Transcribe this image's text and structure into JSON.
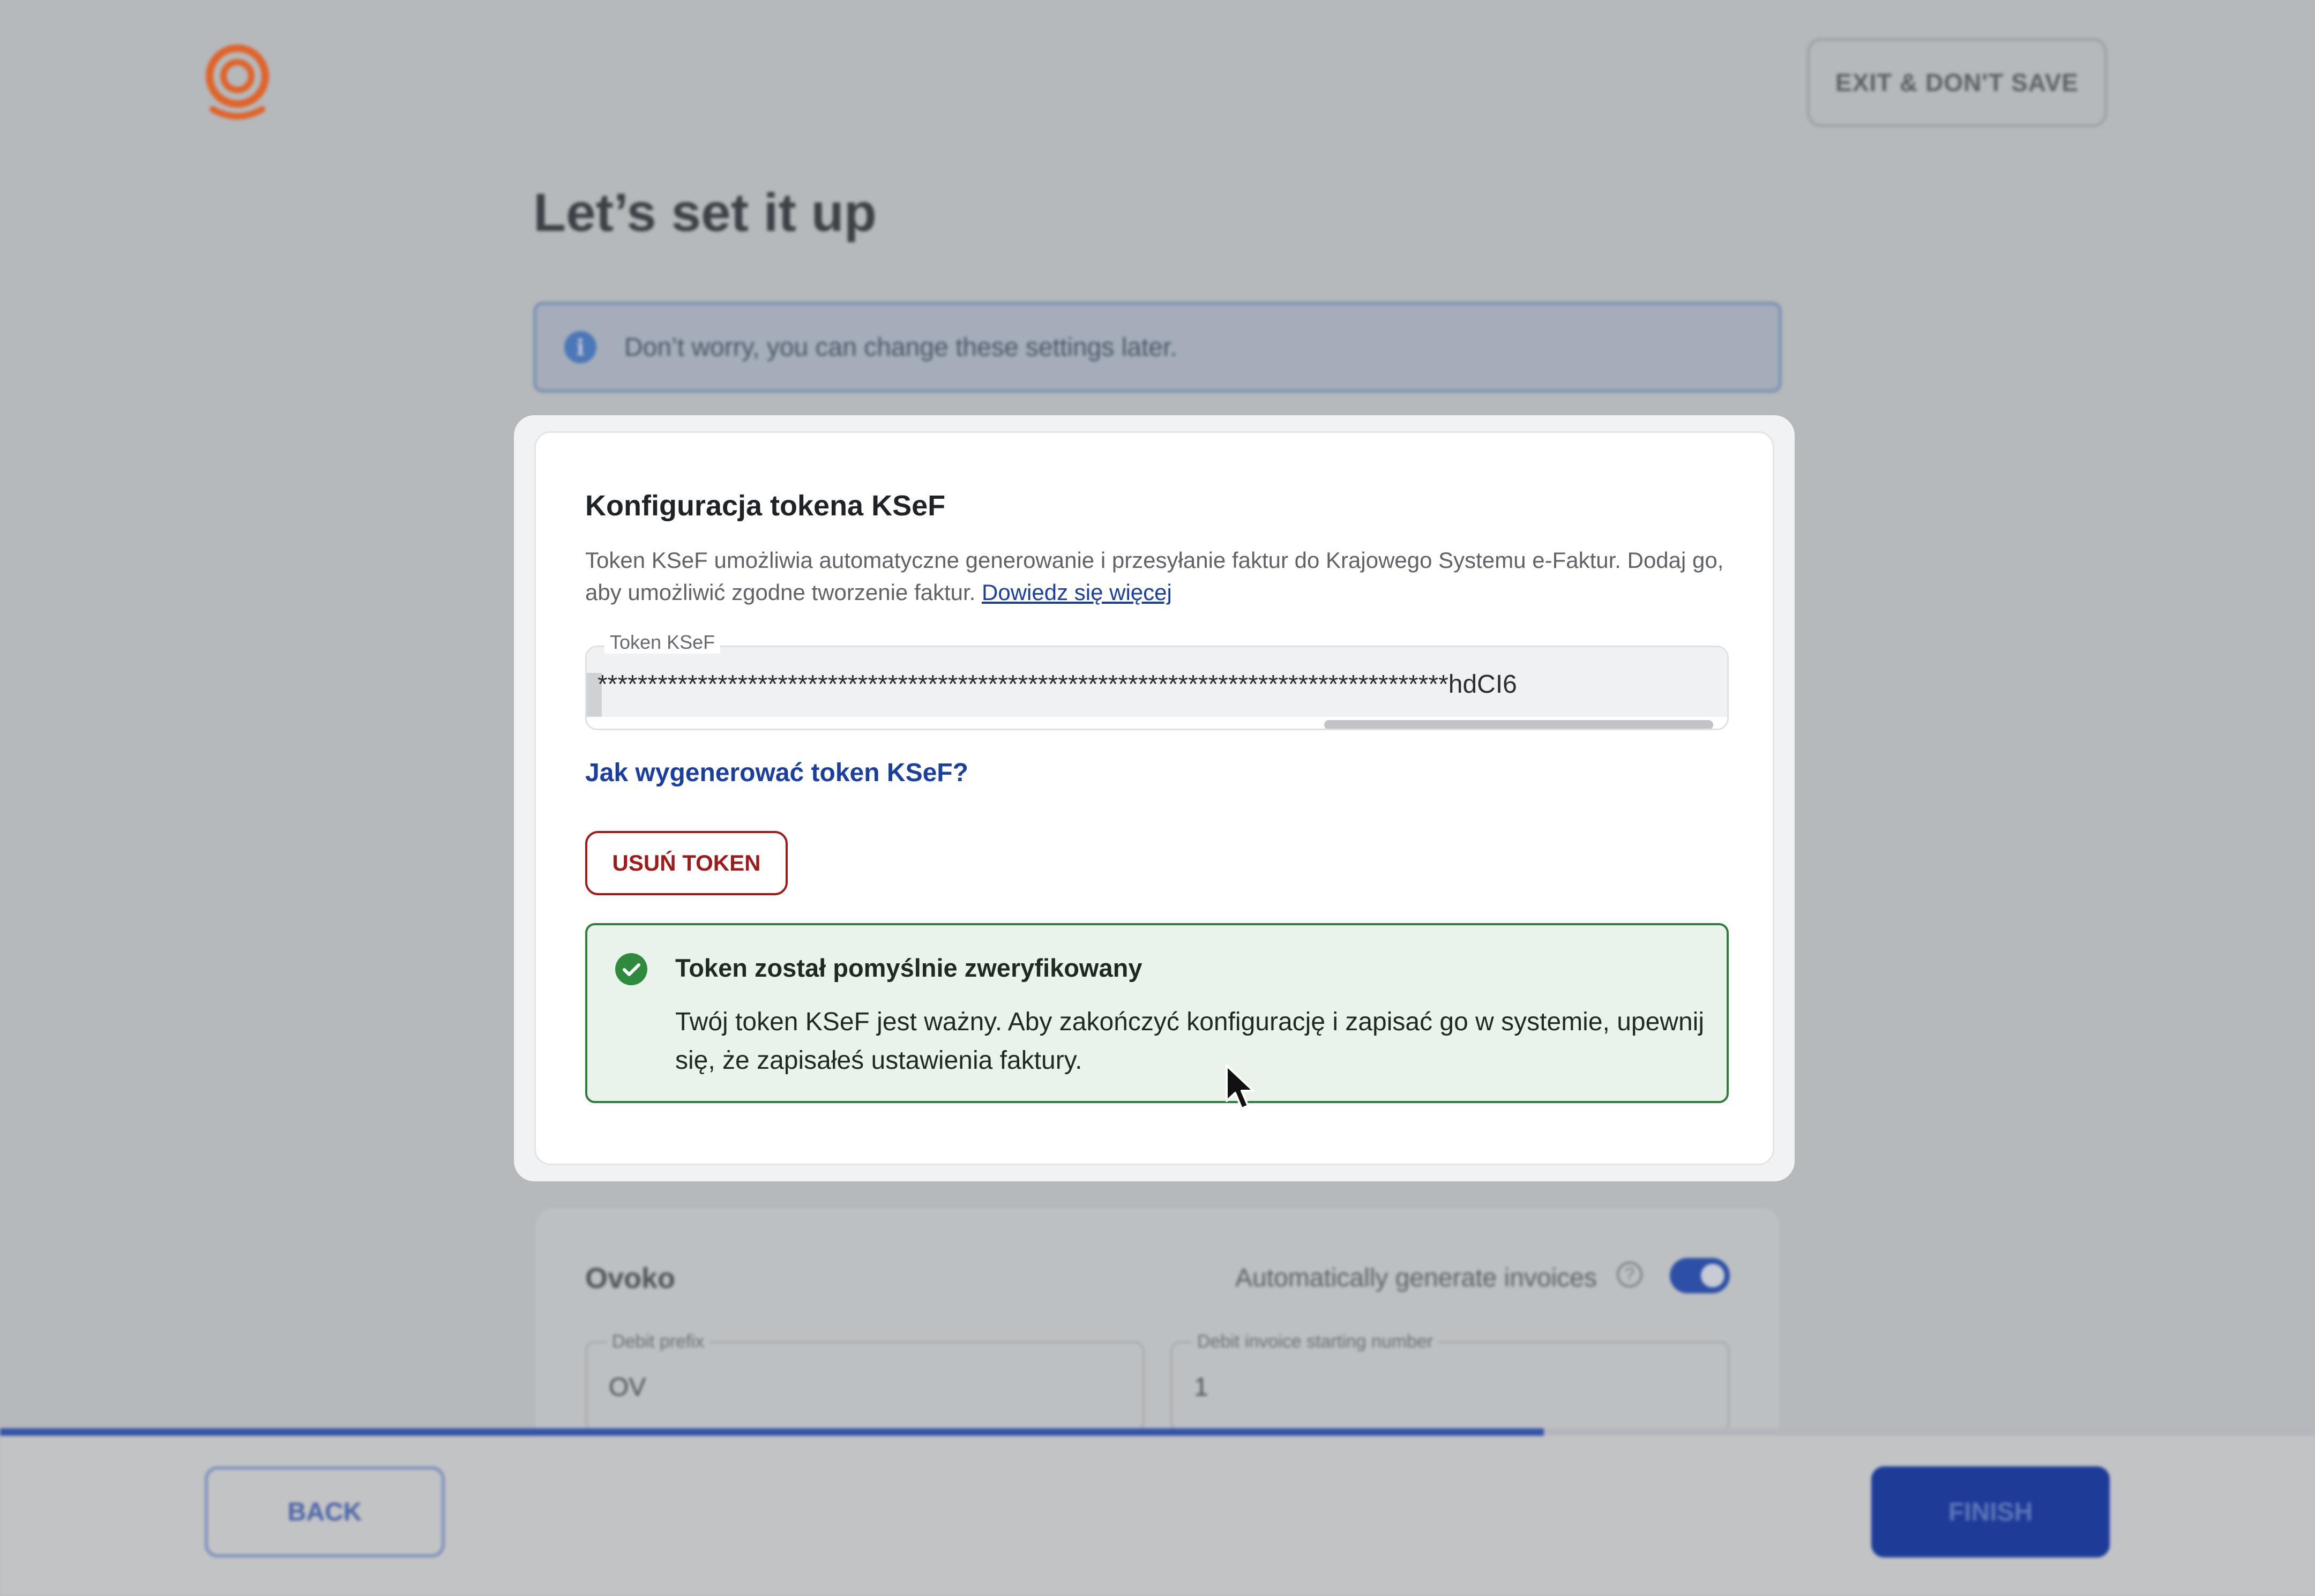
{
  "header": {
    "logo_icon": "ovoko-logo-icon",
    "exit_label": "EXIT & DON'T SAVE"
  },
  "page": {
    "title": "Let’s set it up"
  },
  "info_banner": {
    "icon": "info-icon",
    "text": "Don’t worry, you can change these settings later."
  },
  "ksef_card": {
    "title": "Konfiguracja tokena KSeF",
    "description": "Token KSeF umożliwia automatyczne generowanie i przesyłanie faktur do Krajowego Systemu e-Faktur. Dodaj go, aby umożliwić zgodne tworzenie faktur.",
    "learn_more": "Dowiedz się więcej",
    "token_label": "Token KSeF",
    "token_value": "*************************************************************************************hdCI6",
    "how_to_link": "Jak wygenerować token KSeF?",
    "remove_button": "USUŃ TOKEN",
    "success": {
      "icon": "check-circle-icon",
      "title": "Token został pomyślnie zweryfikowany",
      "body": "Twój token KSeF jest ważny. Aby zakończyć konfigurację i zapisać go w systemie, upewnij się, że zapisałeś ustawienia faktury."
    }
  },
  "ovoko_card": {
    "title": "Ovoko",
    "auto_generate_label": "Automatically generate invoices",
    "auto_generate_on": true,
    "debit_prefix_label": "Debit prefix",
    "debit_prefix_value": "OV",
    "starting_number_label": "Debit invoice starting number",
    "starting_number_value": "1"
  },
  "footer": {
    "progress": 0.667,
    "back_label": "BACK",
    "finish_label": "FINISH"
  },
  "colors": {
    "primary": "#1d3c98",
    "danger": "#a11a1a",
    "success": "#2e8b3e",
    "logo": "#e0642a"
  }
}
